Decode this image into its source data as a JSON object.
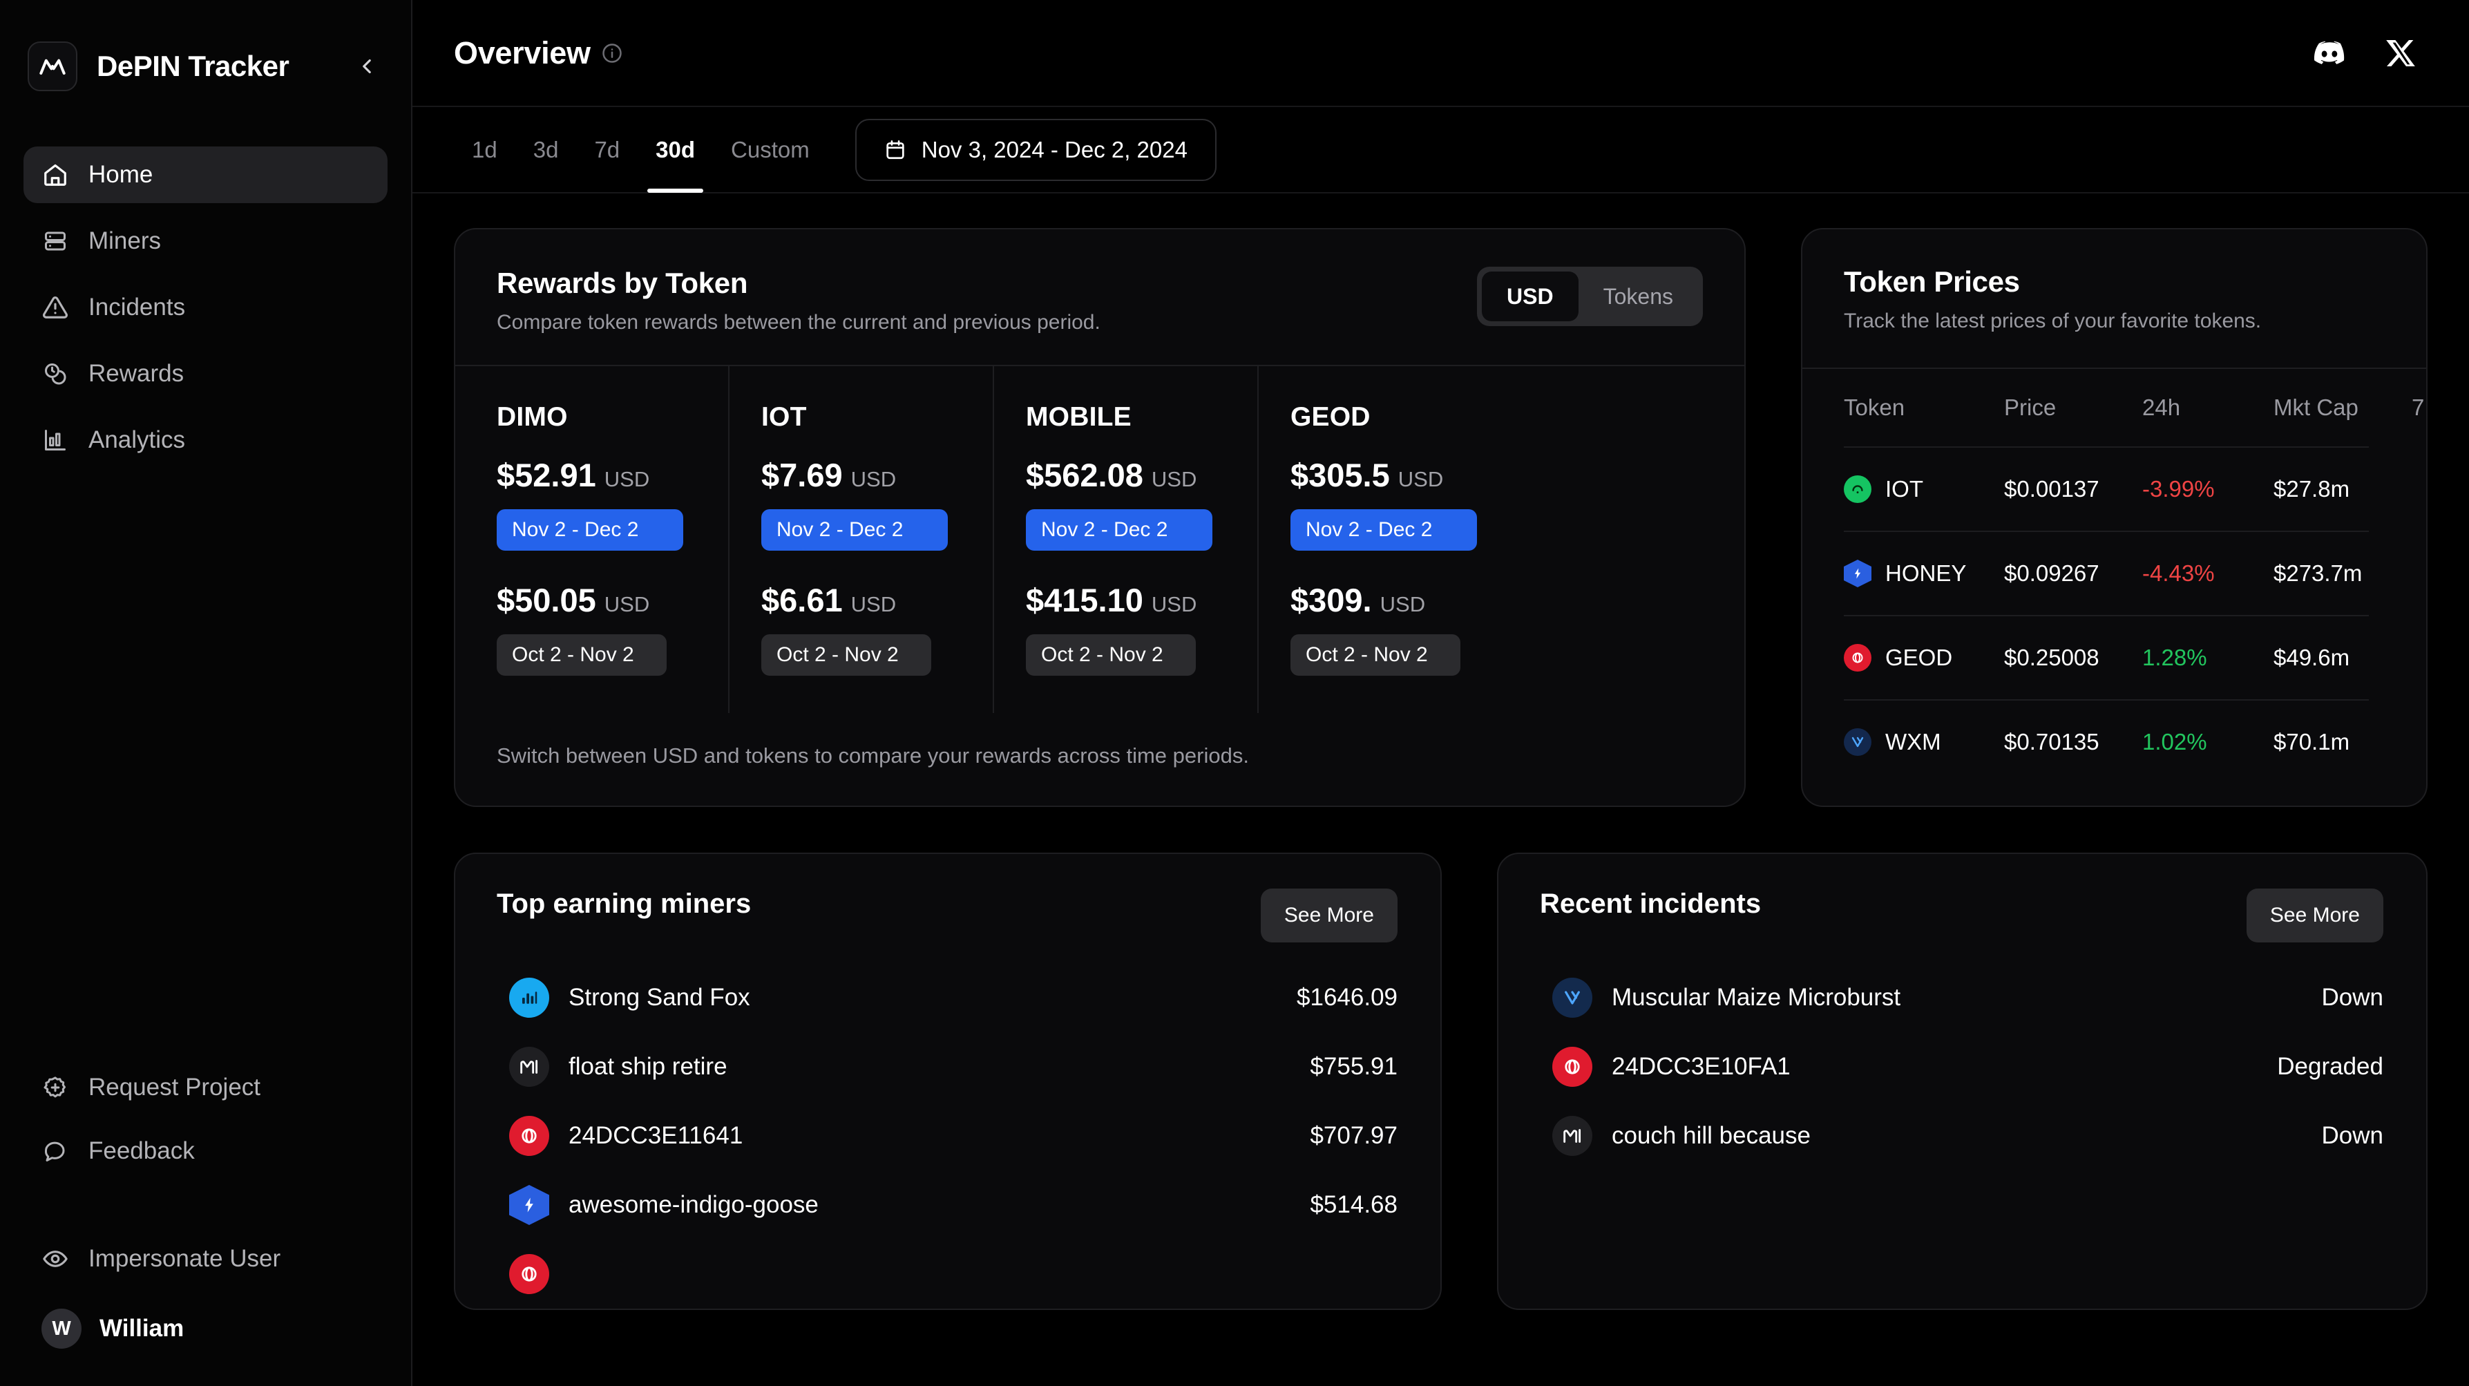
{
  "sidebar": {
    "brand": "DePIN Tracker",
    "collapse_label": "Collapse sidebar",
    "nav": [
      {
        "label": "Home",
        "icon": "home-icon",
        "active": true
      },
      {
        "label": "Miners",
        "icon": "server-icon",
        "active": false
      },
      {
        "label": "Incidents",
        "icon": "warning-triangle-icon",
        "active": false
      },
      {
        "label": "Rewards",
        "icon": "coins-icon",
        "active": false
      },
      {
        "label": "Analytics",
        "icon": "bar-chart-icon",
        "active": false
      }
    ],
    "utilities": [
      {
        "label": "Request Project",
        "icon": "plus-badge-icon"
      },
      {
        "label": "Feedback",
        "icon": "chat-bubble-icon"
      },
      {
        "label": "Impersonate User",
        "icon": "eye-icon"
      }
    ],
    "user": {
      "initial": "W",
      "name": "William"
    }
  },
  "header": {
    "title": "Overview",
    "info_icon": "info-icon",
    "socials": [
      {
        "name": "discord-icon"
      },
      {
        "name": "x-twitter-icon"
      }
    ]
  },
  "range_bar": {
    "tabs": [
      {
        "label": "1d",
        "active": false
      },
      {
        "label": "3d",
        "active": false
      },
      {
        "label": "7d",
        "active": false
      },
      {
        "label": "30d",
        "active": true
      },
      {
        "label": "Custom",
        "active": false
      }
    ],
    "date_range": "Nov 3, 2024 - Dec 2, 2024",
    "calendar_icon": "calendar-icon"
  },
  "rewards": {
    "title": "Rewards by Token",
    "subtitle": "Compare token rewards between the current and previous period.",
    "unit_toggle": {
      "options": [
        "USD",
        "Tokens"
      ],
      "selected": "USD"
    },
    "footer_note": "Switch between USD and tokens to compare your rewards across time periods.",
    "current_period_label": "Nov 2 - Dec 2",
    "previous_period_label": "Oct 2 - Nov 2",
    "currency_unit": "USD",
    "tokens": [
      {
        "name": "DIMO",
        "current": "$52.91",
        "previous": "$50.05"
      },
      {
        "name": "IOT",
        "current": "$7.69",
        "previous": "$6.61"
      },
      {
        "name": "MOBILE",
        "current": "$562.08",
        "previous": "$415.10"
      },
      {
        "name": "GEOD",
        "current": "$305.5",
        "previous": "$309."
      }
    ]
  },
  "token_prices": {
    "title": "Token Prices",
    "subtitle": "Track the latest prices of your favorite tokens.",
    "columns": [
      "Token",
      "Price",
      "24h",
      "Mkt Cap",
      "7"
    ],
    "rows": [
      {
        "token": "IOT",
        "price": "$0.00137",
        "change": "-3.99%",
        "direction": "down",
        "mktcap": "$27.8m",
        "color": "#15c462"
      },
      {
        "token": "HONEY",
        "price": "$0.09267",
        "change": "-4.43%",
        "direction": "down",
        "mktcap": "$273.7m",
        "color": "#2a5fe0"
      },
      {
        "token": "GEOD",
        "price": "$0.25008",
        "change": "1.28%",
        "direction": "up",
        "mktcap": "$49.6m",
        "color": "#e01b2e"
      },
      {
        "token": "WXM",
        "price": "$0.70135",
        "change": "1.02%",
        "direction": "up",
        "mktcap": "$70.1m",
        "color": "#1b3a7a"
      }
    ]
  },
  "top_miners": {
    "title": "Top earning miners",
    "see_more_label": "See More",
    "rows": [
      {
        "name": "Strong Sand Fox",
        "value": "$1646.09",
        "icon": "dimo-token-icon",
        "color": "#18a9f0",
        "shape": "circle"
      },
      {
        "name": "float ship retire",
        "value": "$755.91",
        "icon": "helium-token-icon",
        "color": "#1f1f22",
        "shape": "circle"
      },
      {
        "name": "24DCC3E11641",
        "value": "$707.97",
        "icon": "geodnet-token-icon",
        "color": "#e01b2e",
        "shape": "circle"
      },
      {
        "name": "awesome-indigo-goose",
        "value": "$514.68",
        "icon": "honey-token-icon",
        "color": "#2a5fe0",
        "shape": "hex"
      },
      {
        "name": "",
        "value": "",
        "icon": "geodnet-token-icon",
        "color": "#e01b2e",
        "shape": "circle"
      }
    ]
  },
  "recent_incidents": {
    "title": "Recent incidents",
    "see_more_label": "See More",
    "rows": [
      {
        "name": "Muscular Maize Microburst",
        "status": "Down",
        "icon": "weatherxm-token-icon",
        "color": "#132a4d",
        "shape": "circle"
      },
      {
        "name": "24DCC3E10FA1",
        "status": "Degraded",
        "icon": "geodnet-token-icon",
        "color": "#e01b2e",
        "shape": "circle"
      },
      {
        "name": "couch hill because",
        "status": "Down",
        "icon": "helium-token-icon",
        "color": "#1f1f22",
        "shape": "circle"
      }
    ]
  },
  "colors": {
    "accent_blue": "#2563eb",
    "positive": "#22c55e",
    "negative": "#ef4444",
    "surface": "#0a0a0c",
    "border": "#1e1e21"
  }
}
